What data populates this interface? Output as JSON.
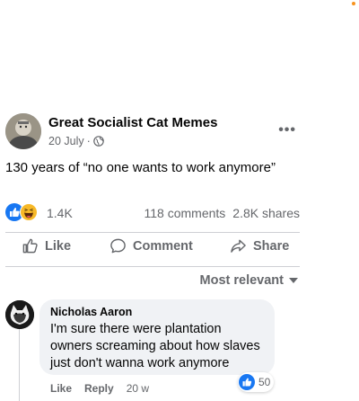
{
  "post": {
    "page_name": "Great Socialist Cat Memes",
    "date": "20 July",
    "separator": "·",
    "more_label": "•••",
    "text": "130 years of “no one wants to work anymore”",
    "reaction_count": "1.4K",
    "comments": "118 comments",
    "shares": "2.8K shares"
  },
  "actions": {
    "like": "Like",
    "comment": "Comment",
    "share": "Share"
  },
  "sort": {
    "label": "Most relevant"
  },
  "comment": {
    "author": "Nicholas Aaron",
    "text": "I'm sure there were plantation owners screaming about how slaves just don't wanna work anymore",
    "like_label": "Like",
    "reply_label": "Reply",
    "time": "20 w",
    "reaction_count": "50"
  },
  "colors": {
    "facebook_blue": "#1877f2",
    "muted_text": "#65676b",
    "bubble_bg": "#f0f2f5",
    "orange_dot": "#f7931e"
  },
  "icons": [
    "globe-icon",
    "more-icon",
    "like-reaction-icon",
    "haha-reaction-icon",
    "thumb-up-outline-icon",
    "comment-icon",
    "share-icon",
    "caret-down-icon"
  ]
}
